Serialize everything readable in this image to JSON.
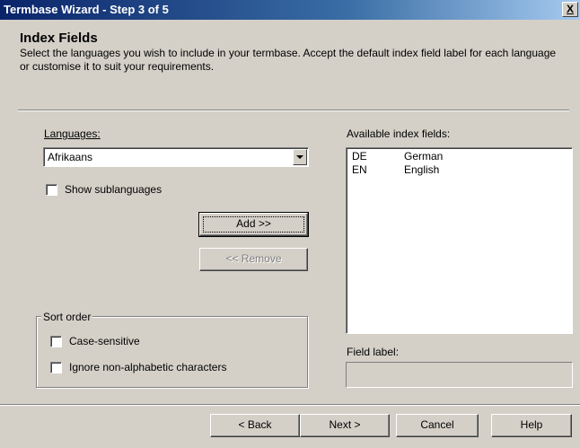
{
  "window": {
    "title": "Termbase Wizard - Step 3 of 5",
    "close_label": "X"
  },
  "page": {
    "heading": "Index Fields",
    "description": "Select the languages you wish to include in your termbase. Accept the default index field label for each language or customise it to suit your requirements."
  },
  "languages": {
    "label": "Languages:",
    "selected": "Afrikaans",
    "show_sublanguages": {
      "label": "Show sublanguages",
      "checked": false
    }
  },
  "buttons": {
    "add": "Add >>",
    "remove": "<< Remove"
  },
  "available": {
    "label": "Available index fields:",
    "items": [
      {
        "code": "DE",
        "name": "German"
      },
      {
        "code": "EN",
        "name": "English"
      }
    ]
  },
  "sort_order": {
    "title": "Sort order",
    "case_sensitive": {
      "label": "Case-sensitive",
      "checked": false
    },
    "ignore_non_alpha": {
      "label": "Ignore non-alphabetic characters",
      "checked": false
    }
  },
  "field_label": {
    "label": "Field label:",
    "value": ""
  },
  "footer": {
    "back": "< Back",
    "next": "Next >",
    "cancel": "Cancel",
    "help": "Help"
  }
}
